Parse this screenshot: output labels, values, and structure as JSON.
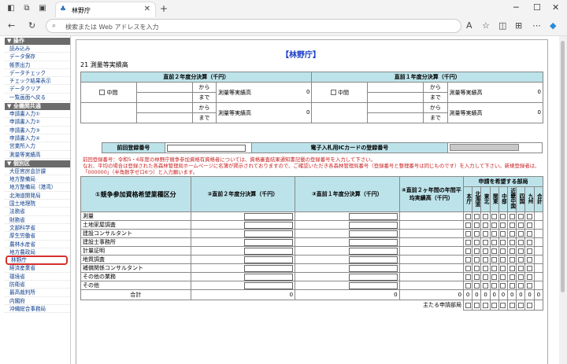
{
  "browser": {
    "tab_title": "林野庁",
    "address_placeholder": "検索または Web アドレスを入力"
  },
  "sidebar": [
    {
      "header": "▼ 操作",
      "items": [
        "読み込み",
        "データ保存",
        "帳票出力",
        "データチェック",
        "チェック結果表示",
        "データクリア",
        "一覧画面へ戻る"
      ]
    },
    {
      "header": "▼ 全機関共通",
      "items": [
        "申請書入力①",
        "申請書入力②",
        "申請書入力③",
        "申請書入力④",
        "営業所入力",
        "測量等実績高"
      ]
    },
    {
      "header": "▼ 個別区",
      "items": [
        "大臣官房会計課",
        "地方整備局",
        "地方整備局（港湾）",
        "北海道開発局",
        "国土地理院",
        "法務省",
        "財務省",
        "文部科学省",
        "厚生労働省",
        "農林水産省",
        "地方農政局",
        "林野庁",
        "経済産業省",
        "環境省",
        "防衛省",
        "最高裁判所",
        "内閣府",
        "沖縄総合事務局"
      ]
    }
  ],
  "page": {
    "title": "【林野庁】",
    "section": "21 測量等実績高"
  },
  "top_table": {
    "h1": "直前２年度分決算（千円）",
    "h2": "直前１年度分決算（千円）",
    "chukan": "中間",
    "kara": "から",
    "made": "まで",
    "label": "測量等実績高",
    "zero": "0"
  },
  "reg": {
    "prev_label": "前回登録番号",
    "ic_label": "電子入札用ICカードの登録番号"
  },
  "note": "前回登録番号：令和5・6年度の林野庁競争参加資格有資格者については、資格審査結果通知書記載の登録番号を入力して下さい。\nなお、平均の場合は登録された各森林管理局ホームページに名簿が掲示されておりますので、ご確認いただき各森林管理局番号（登録番号と整理番号は同じものです）を入力して下さい。新規登録者は、「000000」（半角数字ゼロ6つ）と入力願います。",
  "main_table": {
    "h_col1": "①競争参加資格希望業種区分",
    "h_col2": "②直前２年度分決算（千円）",
    "h_col3": "③直前１年度分決算（千円）",
    "h_col4": "④直前２ヶ年間の年間平均実績高（千円）",
    "h_dept": "申請を希望する部局",
    "depts": [
      "本庁",
      "北海道",
      "東北",
      "関東",
      "中部",
      "近畿中国",
      "四国",
      "九州",
      "合計"
    ],
    "rows": [
      "測量",
      "土地家屋調査",
      "建設コンサルタント",
      "建設士事務所",
      "計量証明",
      "地質調査",
      "補償関係コンサルタント",
      "その他の業務",
      "その他"
    ],
    "total_label": "合計",
    "main_dept_label": "主たる申請部局",
    "zero": "0"
  }
}
